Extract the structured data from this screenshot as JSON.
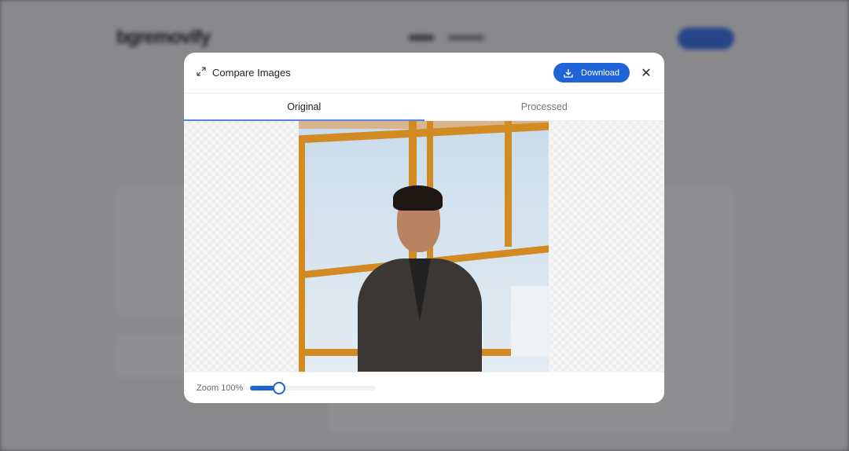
{
  "background": {
    "logo": "bgremovify"
  },
  "modal": {
    "title": "Compare Images",
    "expand_icon": "expand-icon",
    "download_label": "Download",
    "tabs": [
      {
        "label": "Original",
        "active": true
      },
      {
        "label": "Processed",
        "active": false
      }
    ],
    "zoom_label": "Zoom",
    "zoom_value": "100%",
    "zoom_slider_fraction": 0.23
  },
  "colors": {
    "accent": "#1f63d9"
  }
}
